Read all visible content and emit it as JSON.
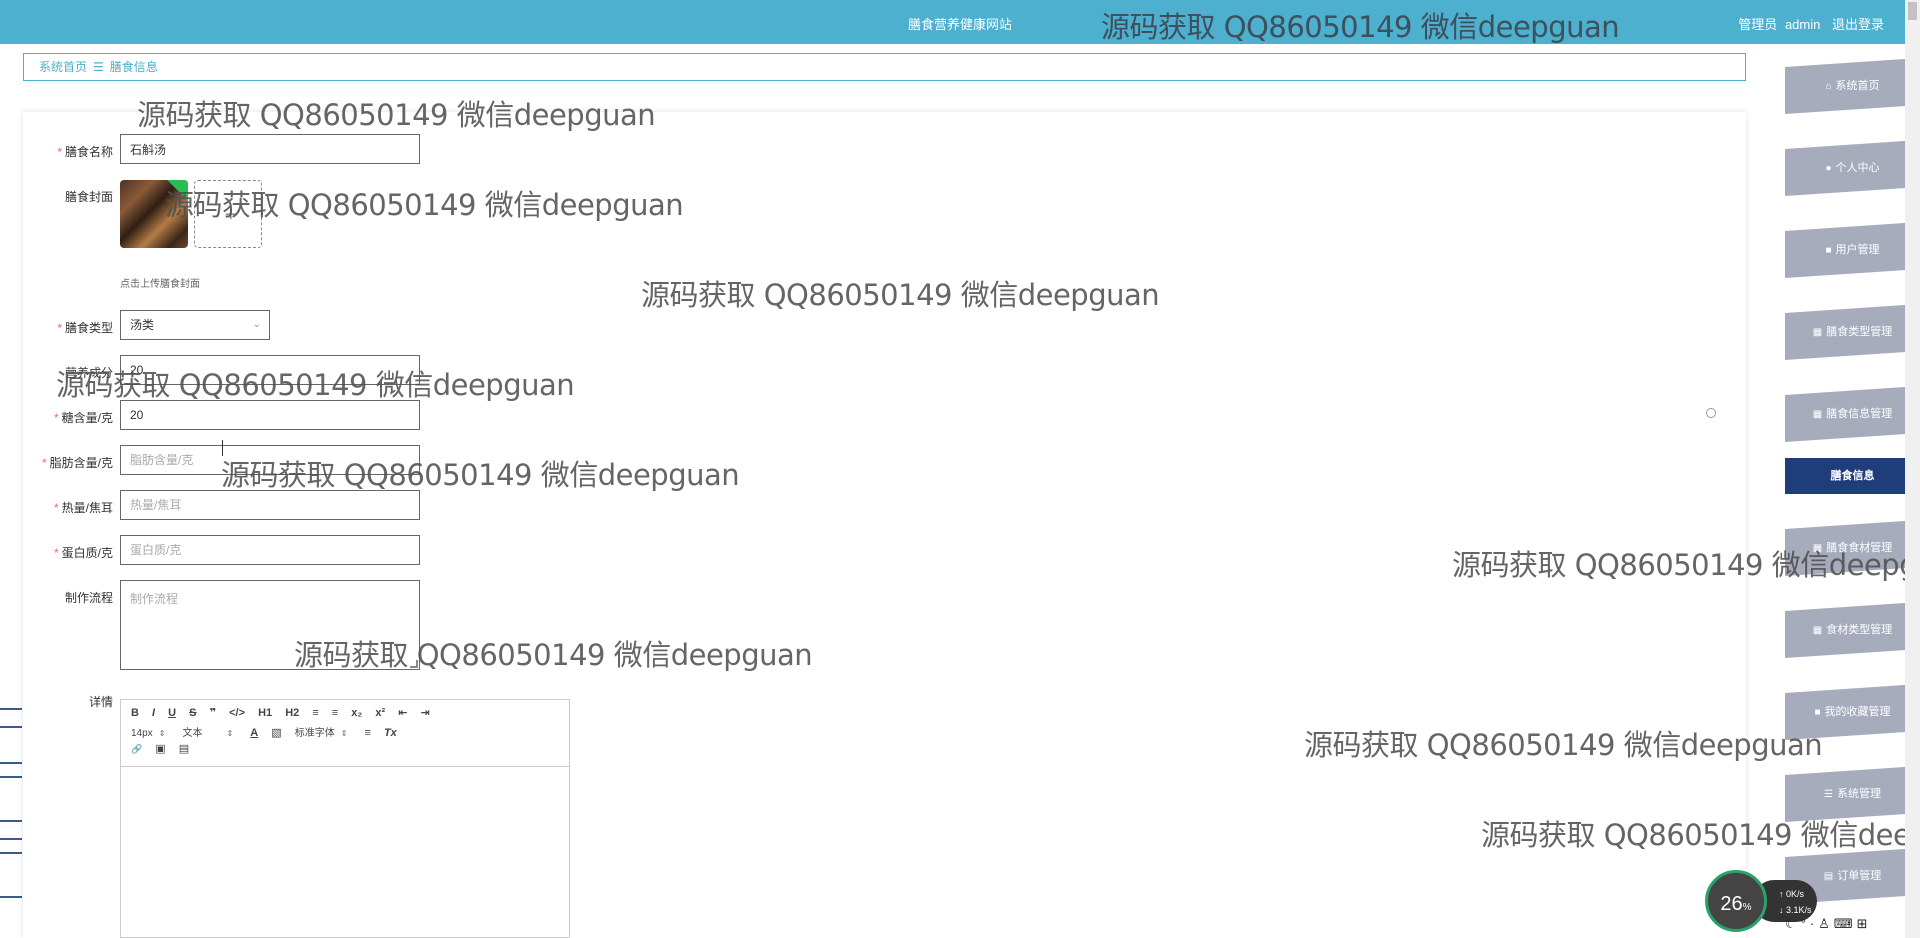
{
  "header": {
    "site_title": "膳食营养健康网站",
    "role_label": "管理员",
    "username": "admin",
    "logout_label": "退出登录"
  },
  "breadcrumb": {
    "home": "系统首页",
    "separator": "☰",
    "current": "膳食信息"
  },
  "form": {
    "name": {
      "label": "膳食名称",
      "value": "石斛汤"
    },
    "cover": {
      "label": "膳食封面",
      "hint": "点击上传膳食封面"
    },
    "type": {
      "label": "膳食类型",
      "value": "汤类"
    },
    "nutrition": {
      "label": "营养成分",
      "value": "20"
    },
    "sugar": {
      "label": "糖含量/克",
      "value": "20"
    },
    "fat": {
      "label": "脂肪含量/克",
      "placeholder": "脂肪含量/克"
    },
    "calories": {
      "label": "热量/焦耳",
      "placeholder": "热量/焦耳"
    },
    "protein": {
      "label": "蛋白质/克",
      "placeholder": "蛋白质/克"
    },
    "process": {
      "label": "制作流程",
      "placeholder": "制作流程"
    },
    "details": {
      "label": "详情"
    }
  },
  "editor": {
    "row1": [
      "B",
      "I",
      "U",
      "S",
      "❞",
      "</>",
      "H1",
      "H2",
      "≡",
      "≡",
      "x₂",
      "x²",
      "⇤",
      "⇥"
    ],
    "font_size": "14px",
    "text_style": "文本",
    "font_family": "标准字体",
    "row2_tools": [
      "A",
      "▧",
      "≡",
      "Tx"
    ],
    "row3": [
      "🔗",
      "▣",
      "▤"
    ]
  },
  "sidebar": {
    "items": [
      {
        "icon": "⌂",
        "label": "系统首页"
      },
      {
        "icon": "●",
        "label": "个人中心"
      },
      {
        "icon": "■",
        "label": "用户管理"
      },
      {
        "icon": "▦",
        "label": "膳食类型管理"
      },
      {
        "icon": "▦",
        "label": "膳食信息管理"
      },
      {
        "icon": "",
        "label": "膳食信息"
      },
      {
        "icon": "▦",
        "label": "膳食食材管理"
      },
      {
        "icon": "▦",
        "label": "食材类型管理"
      },
      {
        "icon": "■",
        "label": "我的收藏管理"
      },
      {
        "icon": "☰",
        "label": "系统管理"
      },
      {
        "icon": "▤",
        "label": "订单管理"
      }
    ]
  },
  "watermark": "源码获取 QQ86050149 微信deepguan",
  "widget": {
    "cpu": "26",
    "cpu_unit": "%",
    "up_speed": "0K/s",
    "down_speed": "3.1K/s"
  },
  "colors": {
    "topbar": "#4db0cf",
    "sidebar_item": "#a7acbd",
    "sidebar_active": "#1e3d7a",
    "required": "#f56c6c"
  }
}
